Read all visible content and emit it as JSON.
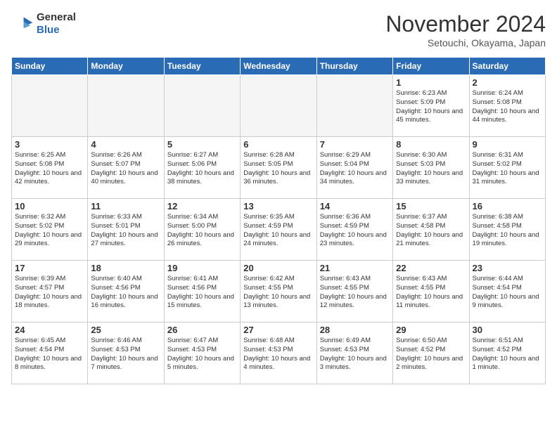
{
  "header": {
    "logo_general": "General",
    "logo_blue": "Blue",
    "month_year": "November 2024",
    "location": "Setouchi, Okayama, Japan"
  },
  "weekdays": [
    "Sunday",
    "Monday",
    "Tuesday",
    "Wednesday",
    "Thursday",
    "Friday",
    "Saturday"
  ],
  "weeks": [
    [
      {
        "day": "",
        "empty": true
      },
      {
        "day": "",
        "empty": true
      },
      {
        "day": "",
        "empty": true
      },
      {
        "day": "",
        "empty": true
      },
      {
        "day": "",
        "empty": true
      },
      {
        "day": "1",
        "sunrise": "6:23 AM",
        "sunset": "5:09 PM",
        "daylight": "10 hours and 45 minutes."
      },
      {
        "day": "2",
        "sunrise": "6:24 AM",
        "sunset": "5:08 PM",
        "daylight": "10 hours and 44 minutes."
      }
    ],
    [
      {
        "day": "3",
        "sunrise": "6:25 AM",
        "sunset": "5:08 PM",
        "daylight": "10 hours and 42 minutes."
      },
      {
        "day": "4",
        "sunrise": "6:26 AM",
        "sunset": "5:07 PM",
        "daylight": "10 hours and 40 minutes."
      },
      {
        "day": "5",
        "sunrise": "6:27 AM",
        "sunset": "5:06 PM",
        "daylight": "10 hours and 38 minutes."
      },
      {
        "day": "6",
        "sunrise": "6:28 AM",
        "sunset": "5:05 PM",
        "daylight": "10 hours and 36 minutes."
      },
      {
        "day": "7",
        "sunrise": "6:29 AM",
        "sunset": "5:04 PM",
        "daylight": "10 hours and 34 minutes."
      },
      {
        "day": "8",
        "sunrise": "6:30 AM",
        "sunset": "5:03 PM",
        "daylight": "10 hours and 33 minutes."
      },
      {
        "day": "9",
        "sunrise": "6:31 AM",
        "sunset": "5:02 PM",
        "daylight": "10 hours and 31 minutes."
      }
    ],
    [
      {
        "day": "10",
        "sunrise": "6:32 AM",
        "sunset": "5:02 PM",
        "daylight": "10 hours and 29 minutes."
      },
      {
        "day": "11",
        "sunrise": "6:33 AM",
        "sunset": "5:01 PM",
        "daylight": "10 hours and 27 minutes."
      },
      {
        "day": "12",
        "sunrise": "6:34 AM",
        "sunset": "5:00 PM",
        "daylight": "10 hours and 26 minutes."
      },
      {
        "day": "13",
        "sunrise": "6:35 AM",
        "sunset": "4:59 PM",
        "daylight": "10 hours and 24 minutes."
      },
      {
        "day": "14",
        "sunrise": "6:36 AM",
        "sunset": "4:59 PM",
        "daylight": "10 hours and 23 minutes."
      },
      {
        "day": "15",
        "sunrise": "6:37 AM",
        "sunset": "4:58 PM",
        "daylight": "10 hours and 21 minutes."
      },
      {
        "day": "16",
        "sunrise": "6:38 AM",
        "sunset": "4:58 PM",
        "daylight": "10 hours and 19 minutes."
      }
    ],
    [
      {
        "day": "17",
        "sunrise": "6:39 AM",
        "sunset": "4:57 PM",
        "daylight": "10 hours and 18 minutes."
      },
      {
        "day": "18",
        "sunrise": "6:40 AM",
        "sunset": "4:56 PM",
        "daylight": "10 hours and 16 minutes."
      },
      {
        "day": "19",
        "sunrise": "6:41 AM",
        "sunset": "4:56 PM",
        "daylight": "10 hours and 15 minutes."
      },
      {
        "day": "20",
        "sunrise": "6:42 AM",
        "sunset": "4:55 PM",
        "daylight": "10 hours and 13 minutes."
      },
      {
        "day": "21",
        "sunrise": "6:43 AM",
        "sunset": "4:55 PM",
        "daylight": "10 hours and 12 minutes."
      },
      {
        "day": "22",
        "sunrise": "6:43 AM",
        "sunset": "4:55 PM",
        "daylight": "10 hours and 11 minutes."
      },
      {
        "day": "23",
        "sunrise": "6:44 AM",
        "sunset": "4:54 PM",
        "daylight": "10 hours and 9 minutes."
      }
    ],
    [
      {
        "day": "24",
        "sunrise": "6:45 AM",
        "sunset": "4:54 PM",
        "daylight": "10 hours and 8 minutes."
      },
      {
        "day": "25",
        "sunrise": "6:46 AM",
        "sunset": "4:53 PM",
        "daylight": "10 hours and 7 minutes."
      },
      {
        "day": "26",
        "sunrise": "6:47 AM",
        "sunset": "4:53 PM",
        "daylight": "10 hours and 5 minutes."
      },
      {
        "day": "27",
        "sunrise": "6:48 AM",
        "sunset": "4:53 PM",
        "daylight": "10 hours and 4 minutes."
      },
      {
        "day": "28",
        "sunrise": "6:49 AM",
        "sunset": "4:53 PM",
        "daylight": "10 hours and 3 minutes."
      },
      {
        "day": "29",
        "sunrise": "6:50 AM",
        "sunset": "4:52 PM",
        "daylight": "10 hours and 2 minutes."
      },
      {
        "day": "30",
        "sunrise": "6:51 AM",
        "sunset": "4:52 PM",
        "daylight": "10 hours and 1 minute."
      }
    ]
  ]
}
